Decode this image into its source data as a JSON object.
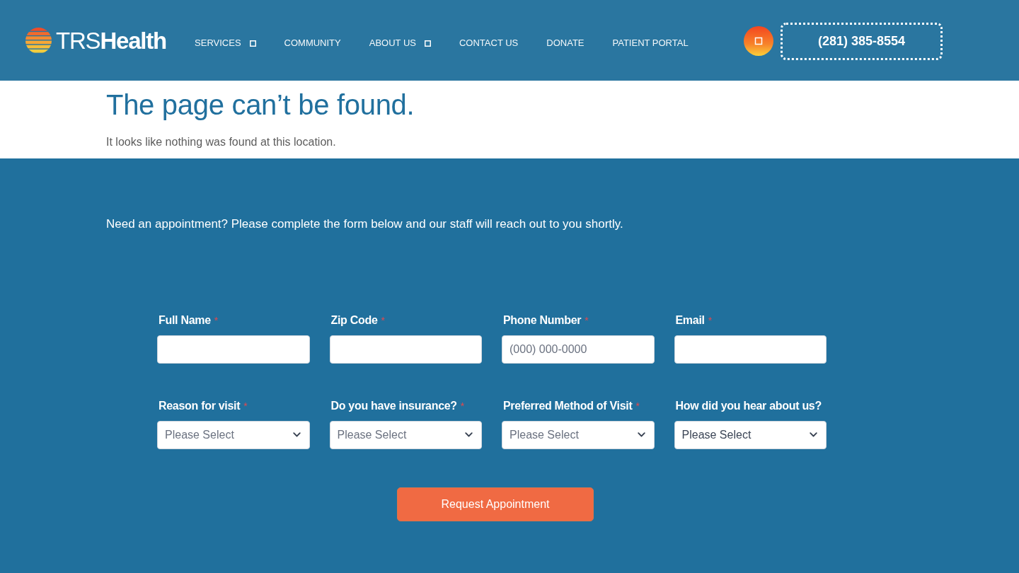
{
  "header": {
    "logo": "TRS**Health**",
    "nav": [
      {
        "label": "SERVICES",
        "has_submenu": true
      },
      {
        "label": "COMMUNITY",
        "has_submenu": false
      },
      {
        "label": "ABOUT US",
        "has_submenu": true
      },
      {
        "label": "CONTACT US",
        "has_submenu": false
      },
      {
        "label": "DONATE",
        "has_submenu": false
      },
      {
        "label": "PATIENT PORTAL",
        "has_submenu": false
      }
    ],
    "phone": "(281) 385-8554"
  },
  "error": {
    "title": "The page can’t be found.",
    "message": "It looks like nothing was found at this location."
  },
  "appointment": {
    "intro": "Need an appointment? Please complete the form below and our staff will reach out to you shortly.",
    "required_mark": "*",
    "fields": [
      {
        "kind": "input",
        "label": "Full Name",
        "required": true
      },
      {
        "kind": "input",
        "label": "Zip Code",
        "required": true
      },
      {
        "kind": "input",
        "label": "Phone Number",
        "required": true,
        "placeholder": "(000) 000-0000"
      },
      {
        "kind": "input",
        "label": "Email",
        "required": true
      },
      {
        "kind": "select",
        "label": "Reason for visit",
        "required": true,
        "placeholder": "Please Select"
      },
      {
        "kind": "select",
        "label": "Do you have insurance?",
        "required": true,
        "placeholder": "Please Select"
      },
      {
        "kind": "select",
        "label": "Preferred Method of Visit",
        "required": true,
        "placeholder": "Please Select"
      },
      {
        "kind": "select",
        "label": "How did you hear about us?",
        "required": false,
        "value": "Please Select"
      }
    ],
    "submit": "Request Appointment"
  }
}
